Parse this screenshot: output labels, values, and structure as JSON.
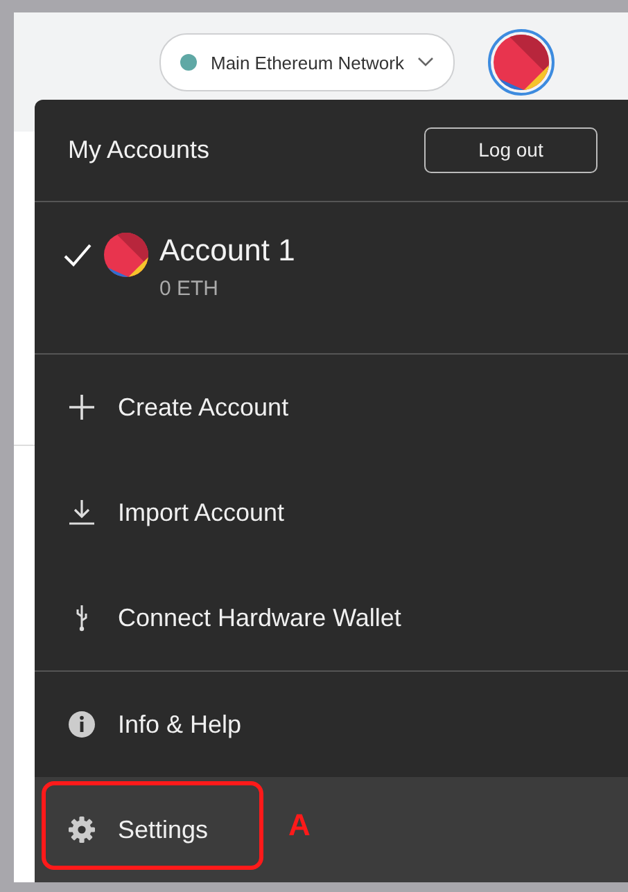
{
  "header": {
    "network": "Main Ethereum Network"
  },
  "menu": {
    "title": "My Accounts",
    "logout": "Log out",
    "accounts": [
      {
        "name": "Account 1",
        "balance": "0 ETH",
        "selected": true
      }
    ],
    "sections": [
      [
        {
          "kind": "plus",
          "label": "Create Account",
          "highlighted": false
        },
        {
          "kind": "download",
          "label": "Import Account",
          "highlighted": false
        },
        {
          "kind": "usb",
          "label": "Connect Hardware Wallet",
          "highlighted": false
        }
      ],
      [
        {
          "kind": "info",
          "label": "Info & Help",
          "highlighted": false
        },
        {
          "kind": "gear",
          "label": "Settings",
          "highlighted": true,
          "callout": "A"
        }
      ]
    ]
  }
}
